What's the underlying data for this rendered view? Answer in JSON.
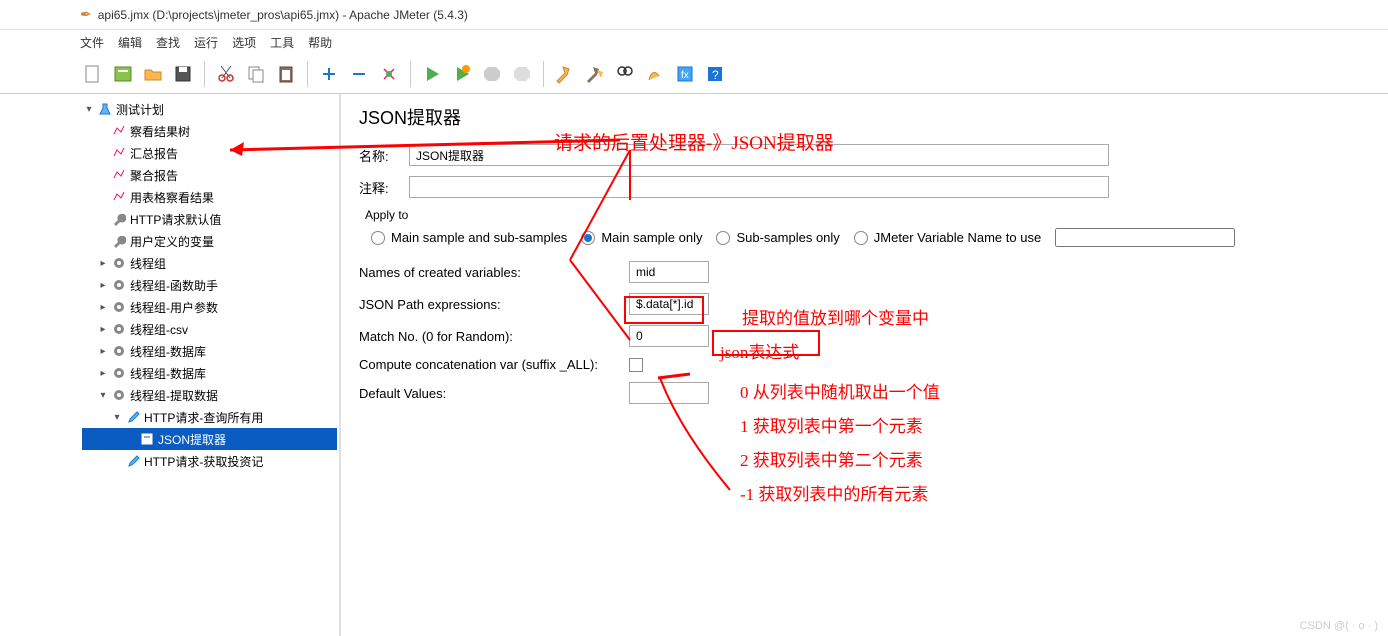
{
  "window": {
    "title": "api65.jmx (D:\\projects\\jmeter_pros\\api65.jmx) - Apache JMeter (5.4.3)"
  },
  "menu": {
    "file": "文件",
    "edit": "编辑",
    "search": "查找",
    "run": "运行",
    "options": "选项",
    "tools": "工具",
    "help": "帮助"
  },
  "tree": {
    "root": "测试计划",
    "items": [
      "察看结果树",
      "汇总报告",
      "聚合报告",
      "用表格察看结果",
      "HTTP请求默认值",
      "用户定义的变量",
      "线程组",
      "线程组-函数助手",
      "线程组-用户参数",
      "线程组-csv",
      "线程组-数据库",
      "线程组-数据库",
      "线程组-提取数据"
    ],
    "sub1": "HTTP请求-查询所有用",
    "sub1a": "JSON提取器",
    "sub2": "HTTP请求-获取投资记"
  },
  "panel": {
    "title": "JSON提取器",
    "name_label": "名称:",
    "name_value": "JSON提取器",
    "comment_label": "注释:",
    "apply_label": "Apply to",
    "radio1": "Main sample and sub-samples",
    "radio2": "Main sample only",
    "radio3": "Sub-samples only",
    "radio4": "JMeter Variable Name to use",
    "names_label": "Names of created variables:",
    "names_value": "mid",
    "json_label": "JSON Path expressions:",
    "json_value": "$.data[*].id",
    "match_label": "Match No. (0 for Random):",
    "match_value": "0",
    "concat_label": "Compute concatenation var (suffix _ALL):",
    "default_label": "Default Values:"
  },
  "annotations": {
    "a1": "请求的后置处理器-》JSON提取器",
    "a2": "提取的值放到哪个变量中",
    "a3": "json表达式",
    "a4": "0    从列表中随机取出一个值",
    "a5": "1    获取列表中第一个元素",
    "a6": "2    获取列表中第二个元素",
    "a7": "-1  获取列表中的所有元素"
  },
  "watermark": "CSDN @( · o · )"
}
